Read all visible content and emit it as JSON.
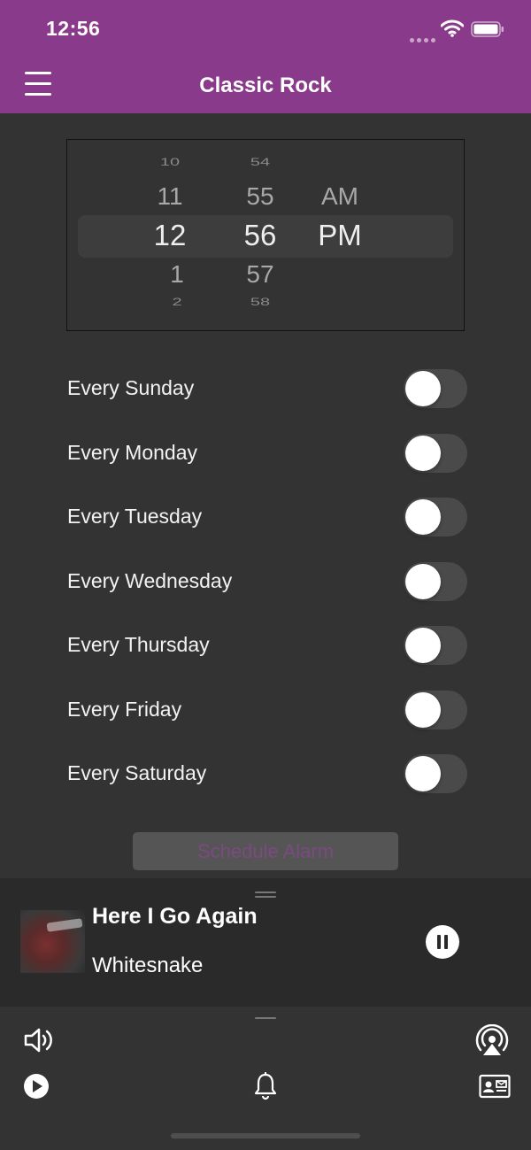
{
  "status": {
    "time": "12:56"
  },
  "header": {
    "title": "Classic Rock",
    "bg_color": "#8a3a8a"
  },
  "picker": {
    "hours": [
      "10",
      "11",
      "12",
      "1",
      "2"
    ],
    "minutes": [
      "54",
      "55",
      "56",
      "57",
      "58"
    ],
    "periods": [
      "AM",
      "PM"
    ],
    "selected": {
      "hour": "12",
      "minute": "56",
      "period": "PM"
    }
  },
  "days": [
    {
      "label": "Every Sunday",
      "enabled": false
    },
    {
      "label": "Every Monday",
      "enabled": false
    },
    {
      "label": "Every Tuesday",
      "enabled": false
    },
    {
      "label": "Every Wednesday",
      "enabled": false
    },
    {
      "label": "Every Thursday",
      "enabled": false
    },
    {
      "label": "Every Friday",
      "enabled": false
    },
    {
      "label": "Every Saturday",
      "enabled": false
    }
  ],
  "schedule_button": {
    "label": "Schedule Alarm",
    "enabled": false
  },
  "now_playing": {
    "title": "Here I Go Again",
    "artist": "Whitesnake",
    "state": "playing"
  },
  "bottom_icons": [
    "volume-icon",
    "airplay-icon",
    "play-icon",
    "bell-icon",
    "contact-card-icon"
  ]
}
